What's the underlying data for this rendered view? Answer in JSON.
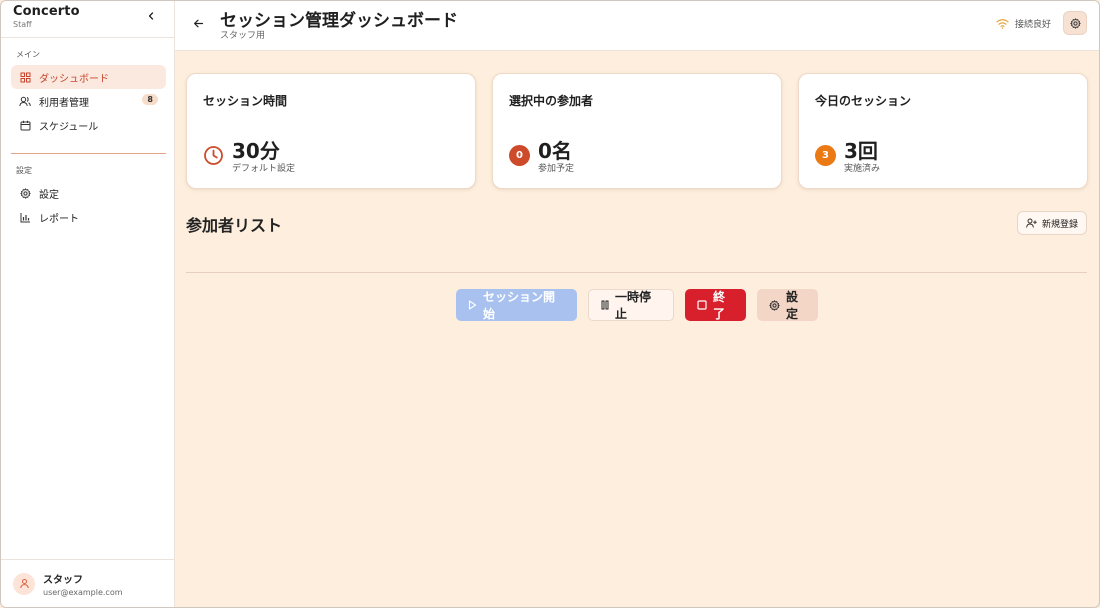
{
  "sidebar": {
    "brand": {
      "name": "Concerto",
      "sub": "Staff"
    },
    "section_main": "メイン",
    "section_settings": "設定",
    "items": [
      {
        "label": "ダッシュボード",
        "icon": "grid-icon",
        "active": true
      },
      {
        "label": "利用者管理",
        "icon": "users-icon",
        "badge": "8"
      },
      {
        "label": "スケジュール",
        "icon": "calendar-icon"
      },
      {
        "label": "設定",
        "icon": "gear-icon"
      },
      {
        "label": "レポート",
        "icon": "bar-chart-icon"
      }
    ],
    "user": {
      "name": "スタッフ",
      "email": "user@example.com"
    }
  },
  "header": {
    "title": "セッション管理ダッシュボード",
    "subtitle": "スタッフ用",
    "connection": "接続良好"
  },
  "cards": [
    {
      "title": "セッション時間",
      "value": "30分",
      "caption": "デフォルト設定",
      "icon": "clock-icon"
    },
    {
      "title": "選択中の参加者",
      "value": "0名",
      "caption": "参加予定",
      "badge": "0",
      "color": "#cd4a2b"
    },
    {
      "title": "今日のセッション",
      "value": "3回",
      "caption": "実施済み",
      "badge": "3",
      "color": "#ec7a14"
    }
  ],
  "participants": {
    "title": "参加者リスト",
    "new_button": "新規登録"
  },
  "controls": {
    "start": "セッション開始",
    "pause": "一時停止",
    "end": "終了",
    "settings": "設定"
  },
  "colors": {
    "accent": "#c8452c",
    "background": "#fdeedd",
    "start": "#a8c1ef",
    "end": "#d81f2c"
  }
}
